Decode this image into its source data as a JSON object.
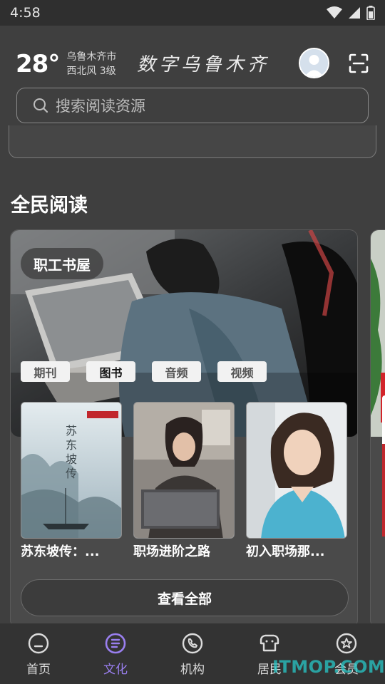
{
  "status_bar": {
    "time": "4:58"
  },
  "header": {
    "temperature": "28°",
    "city": "乌鲁木齐市",
    "wind": "西北风 3级",
    "app_title": "数字乌鲁木齐"
  },
  "search": {
    "placeholder": "搜索阅读资源"
  },
  "section": {
    "title": "全民阅读"
  },
  "card": {
    "tag": "职工书屋",
    "tabs": [
      "期刊",
      "图书",
      "音频",
      "视频"
    ],
    "active_tab": "图书",
    "books": [
      {
        "title": "苏东坡传：..."
      },
      {
        "title": "职场进阶之路"
      },
      {
        "title": "初入职场那..."
      }
    ],
    "view_all_label": "查看全部"
  },
  "bottom_nav": {
    "items": [
      {
        "label": "首页",
        "icon": "home-icon"
      },
      {
        "label": "文化",
        "icon": "culture-icon"
      },
      {
        "label": "机构",
        "icon": "phone-icon"
      },
      {
        "label": "居民",
        "icon": "resident-icon"
      },
      {
        "label": "会员",
        "icon": "member-icon"
      }
    ],
    "active": "文化"
  },
  "watermark": "ITMOP.COM",
  "colors": {
    "accent": "#9a7ff0",
    "background": "#3f3f3f"
  }
}
